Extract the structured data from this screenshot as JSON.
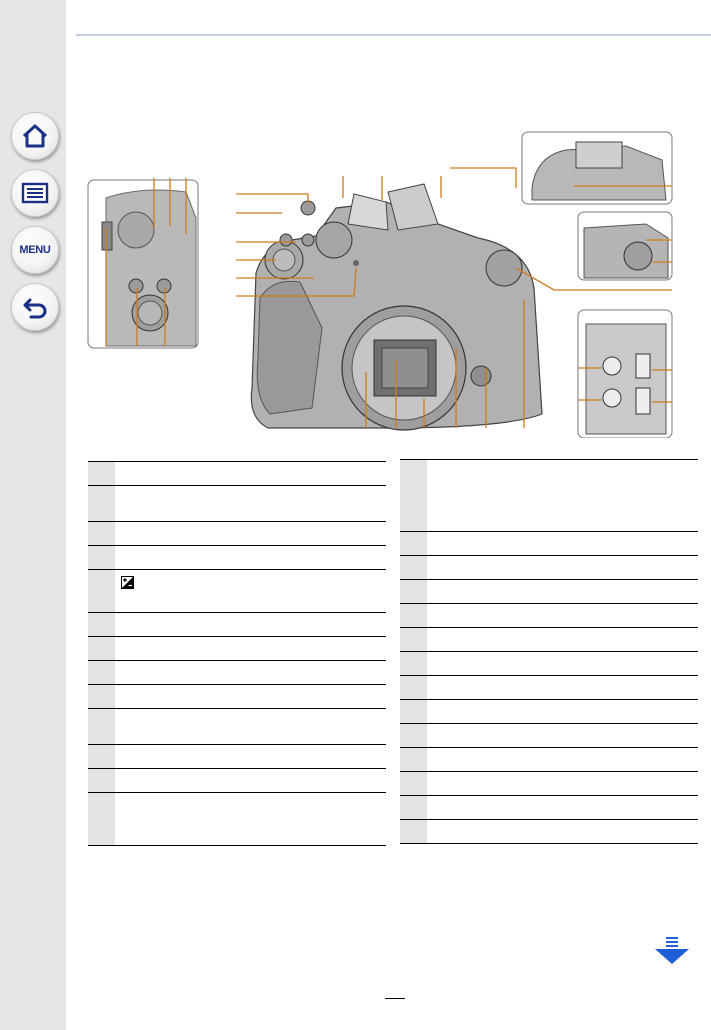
{
  "sidebar": {
    "items": [
      {
        "name": "home",
        "icon": "home-icon"
      },
      {
        "name": "contents",
        "icon": "list-icon"
      },
      {
        "name": "menu",
        "icon": "menu-icon",
        "label": "MENU"
      },
      {
        "name": "back",
        "icon": "back-arrow-icon"
      }
    ]
  },
  "colors": {
    "accent": "#1a2f86",
    "sidebar_bg": "#e6e6e6",
    "table_number_bg": "#e3e3e3",
    "rule": "#c4cce6",
    "next_arrow": "#1f5fd6"
  },
  "table_left": {
    "rows": [
      {
        "height": 24
      },
      {
        "height": 36
      },
      {
        "height": 24
      },
      {
        "height": 24
      },
      {
        "height": 43,
        "icon": "exposure-compensation-icon"
      },
      {
        "height": 24
      },
      {
        "height": 24
      },
      {
        "height": 24
      },
      {
        "height": 24
      },
      {
        "height": 36
      },
      {
        "height": 24
      },
      {
        "height": 24
      },
      {
        "height": 53
      }
    ]
  },
  "table_right": {
    "rows": [
      {
        "height": 72
      },
      {
        "height": 24
      },
      {
        "height": 24
      },
      {
        "height": 24
      },
      {
        "height": 24
      },
      {
        "height": 24
      },
      {
        "height": 24
      },
      {
        "height": 24
      },
      {
        "height": 24
      },
      {
        "height": 24
      },
      {
        "height": 24
      },
      {
        "height": 24
      },
      {
        "height": 24
      },
      {
        "height": 24
      }
    ]
  },
  "page_number": "",
  "next_icon": "next-page-arrow-icon"
}
